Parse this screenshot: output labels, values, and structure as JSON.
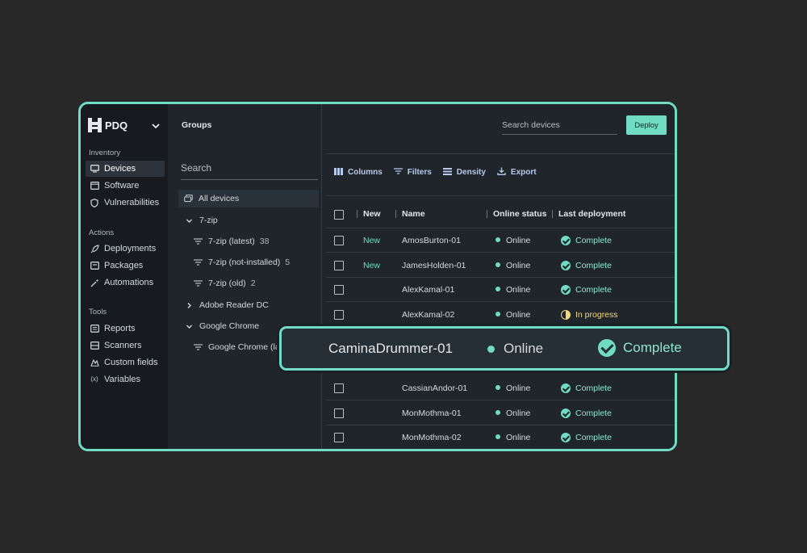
{
  "brand": {
    "name": "PDQ"
  },
  "nav": {
    "sections": [
      {
        "title": "Inventory",
        "items": [
          {
            "label": "Devices",
            "icon": "monitor-icon",
            "active": true
          },
          {
            "label": "Software",
            "icon": "software-icon"
          },
          {
            "label": "Vulnerabilities",
            "icon": "shield-icon"
          }
        ]
      },
      {
        "title": "Actions",
        "items": [
          {
            "label": "Deployments",
            "icon": "rocket-icon"
          },
          {
            "label": "Packages",
            "icon": "package-icon"
          },
          {
            "label": "Automations",
            "icon": "wand-icon"
          }
        ]
      },
      {
        "title": "Tools",
        "items": [
          {
            "label": "Reports",
            "icon": "report-icon"
          },
          {
            "label": "Scanners",
            "icon": "scanner-icon"
          },
          {
            "label": "Custom fields",
            "icon": "custom-fields-icon"
          },
          {
            "label": "Variables",
            "icon": "variables-icon"
          }
        ]
      }
    ]
  },
  "groups": {
    "title": "Groups",
    "search_placeholder": "Search",
    "items": [
      {
        "label": "All devices",
        "type": "all",
        "selected": true
      },
      {
        "label": "7-zip",
        "type": "folder-open"
      },
      {
        "label": "7-zip (latest)",
        "type": "filter",
        "count": "38"
      },
      {
        "label": "7-zip (not-installed)",
        "type": "filter",
        "count": "5"
      },
      {
        "label": "7-zip (old)",
        "type": "filter",
        "count": "2"
      },
      {
        "label": "Adobe Reader DC",
        "type": "folder-closed"
      },
      {
        "label": "Google Chrome",
        "type": "folder-open"
      },
      {
        "label": "Google Chrome (lat",
        "type": "filter"
      }
    ]
  },
  "header": {
    "search_placeholder": "Search devices",
    "deploy_label": "Deploy"
  },
  "toolbar": {
    "columns": "Columns",
    "filters": "Filters",
    "density": "Density",
    "export": "Export"
  },
  "table": {
    "columns": [
      "New",
      "Name",
      "Online status",
      "Last deployment"
    ],
    "rows": [
      {
        "new": "New",
        "name": "AmosBurton-01",
        "status": "Online",
        "deployment": "Complete",
        "state": "complete"
      },
      {
        "new": "New",
        "name": "JamesHolden-01",
        "status": "Online",
        "deployment": "Complete",
        "state": "complete"
      },
      {
        "new": "",
        "name": "AlexKamal-01",
        "status": "Online",
        "deployment": "Complete",
        "state": "complete"
      },
      {
        "new": "",
        "name": "AlexKamal-02",
        "status": "Online",
        "deployment": "In progress",
        "state": "progress"
      },
      {
        "new": "",
        "name": "CassianAndor-01",
        "status": "Online",
        "deployment": "Complete",
        "state": "complete"
      },
      {
        "new": "",
        "name": "MonMothma-01",
        "status": "Online",
        "deployment": "Complete",
        "state": "complete"
      },
      {
        "new": "",
        "name": "MonMothma-02",
        "status": "Online",
        "deployment": "Complete",
        "state": "complete"
      }
    ]
  },
  "callout": {
    "name": "CaminaDrummer-01",
    "status": "Online",
    "deployment": "Complete"
  },
  "colors": {
    "accent": "#6fdcc3",
    "progress": "#f0d87a",
    "background": "#282828",
    "panel": "#1f252b"
  }
}
